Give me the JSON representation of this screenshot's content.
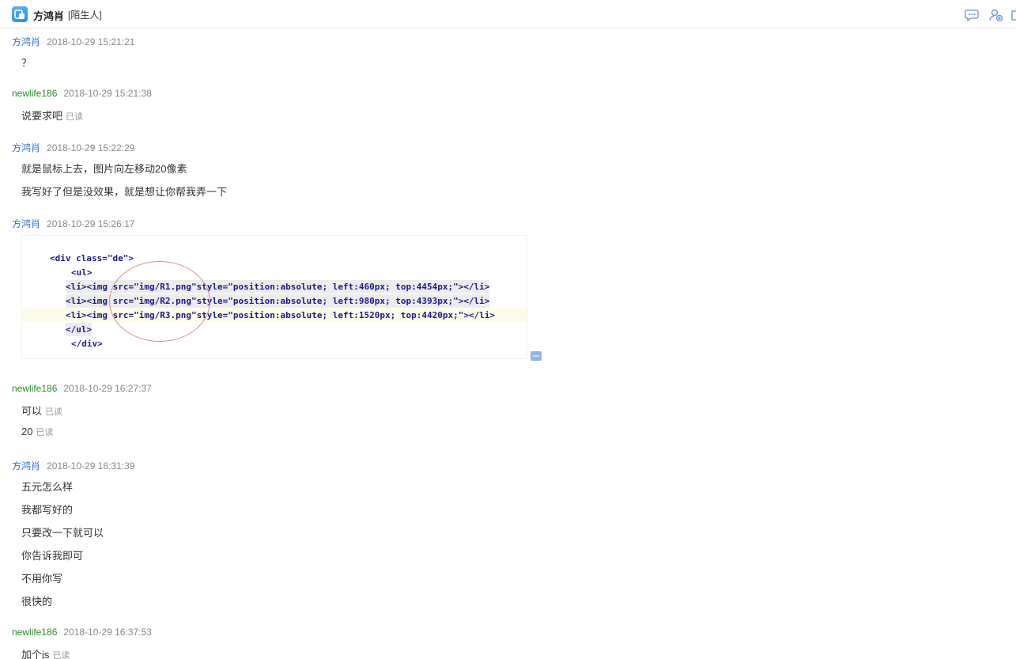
{
  "header": {
    "contact_name": "方鸿肖",
    "contact_tag": "[陌生人]",
    "icons": [
      "chat-bubble-icon",
      "add-contact-icon",
      "folder-icon"
    ]
  },
  "users": {
    "a": "方鸿肖",
    "b": "newlife186"
  },
  "read_label": "已读",
  "messages": [
    {
      "sender": "方鸿肖",
      "time": "2018-10-29 15:21:21",
      "lines": [
        "？"
      ]
    },
    {
      "sender": "newlife186",
      "time": "2018-10-29 15:21:38",
      "lines": [
        "说要求吧"
      ]
    },
    {
      "sender": "方鸿肖",
      "time": "2018-10-29 15:22:29",
      "lines": [
        "就是鼠标上去，图片向左移动20像素",
        "我写好了但是没效果，就是想让你帮我弄一下"
      ]
    },
    {
      "sender": "方鸿肖",
      "time": "2018-10-29 15:26:17",
      "lines": []
    },
    {
      "sender": "newlife186",
      "time": "2018-10-29 16:27:37",
      "lines": [
        "可以",
        "20"
      ]
    },
    {
      "sender": "方鸿肖",
      "time": "2018-10-29 16:31:39",
      "lines": [
        "五元怎么样",
        "我都写好的",
        "只要改一下就可以",
        "你告诉我即可",
        "不用你写",
        "很快的"
      ]
    },
    {
      "sender": "newlife186",
      "time": "2018-10-29 16:37:53",
      "lines": [
        "加个js"
      ]
    }
  ],
  "code_image": {
    "lines": [
      "<div class=\"de\">",
      "<ul>",
      "<li><img src=\"img/R1.png\"style=\"position:absolute; left:460px; top:4454px;\"></li>",
      "<li><img src=\"img/R2.png\"style=\"position:absolute; left:980px; top:4393px;\"></li>",
      "<li><img src=\"img/R3.png\"style=\"position:absolute; left:1520px; top:4420px;\"></li>",
      "</ul>",
      "</div>"
    ]
  }
}
